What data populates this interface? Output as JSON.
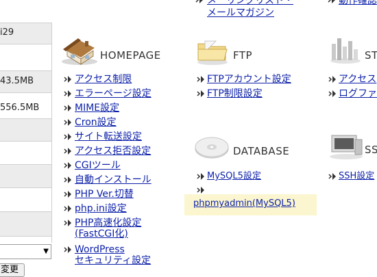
{
  "top_links": {
    "mail_magazine": "メールマガジン",
    "mail_list": "メーリングリスト・",
    "operation_check": "動作確認"
  },
  "left_panel": {
    "values": [
      "i29",
      "43.5MB",
      "556.5MB"
    ],
    "change_button": "変更"
  },
  "homepage": {
    "title": "HOMEPAGE",
    "links": [
      "アクセス制限",
      "エラーページ設定",
      "MIME設定",
      "Cron設定",
      "サイト転送設定",
      "アクセス拒否設定",
      "CGIツール",
      "自動インストール",
      "PHP Ver.切替",
      "php.ini設定",
      "PHP高速化設定",
      "(FastCGI化)",
      "WordPress",
      "セキュリティ設定"
    ]
  },
  "ftp": {
    "title": "FTP",
    "links": [
      "FTPアカウント設定",
      "FTP制限設定"
    ]
  },
  "database": {
    "title": "DATABASE",
    "links": [
      "MySQL5設定",
      "phpmyadmin(MySQL5)"
    ]
  },
  "stats": {
    "title": "ST",
    "links": [
      "アクセス",
      "ログファ"
    ]
  },
  "ssh": {
    "title": "SS",
    "links": [
      "SSH設定"
    ]
  },
  "colors": {
    "link": "#0b1fa8",
    "highlight": "#fbf6cf",
    "panel_shade": "#ececec"
  }
}
